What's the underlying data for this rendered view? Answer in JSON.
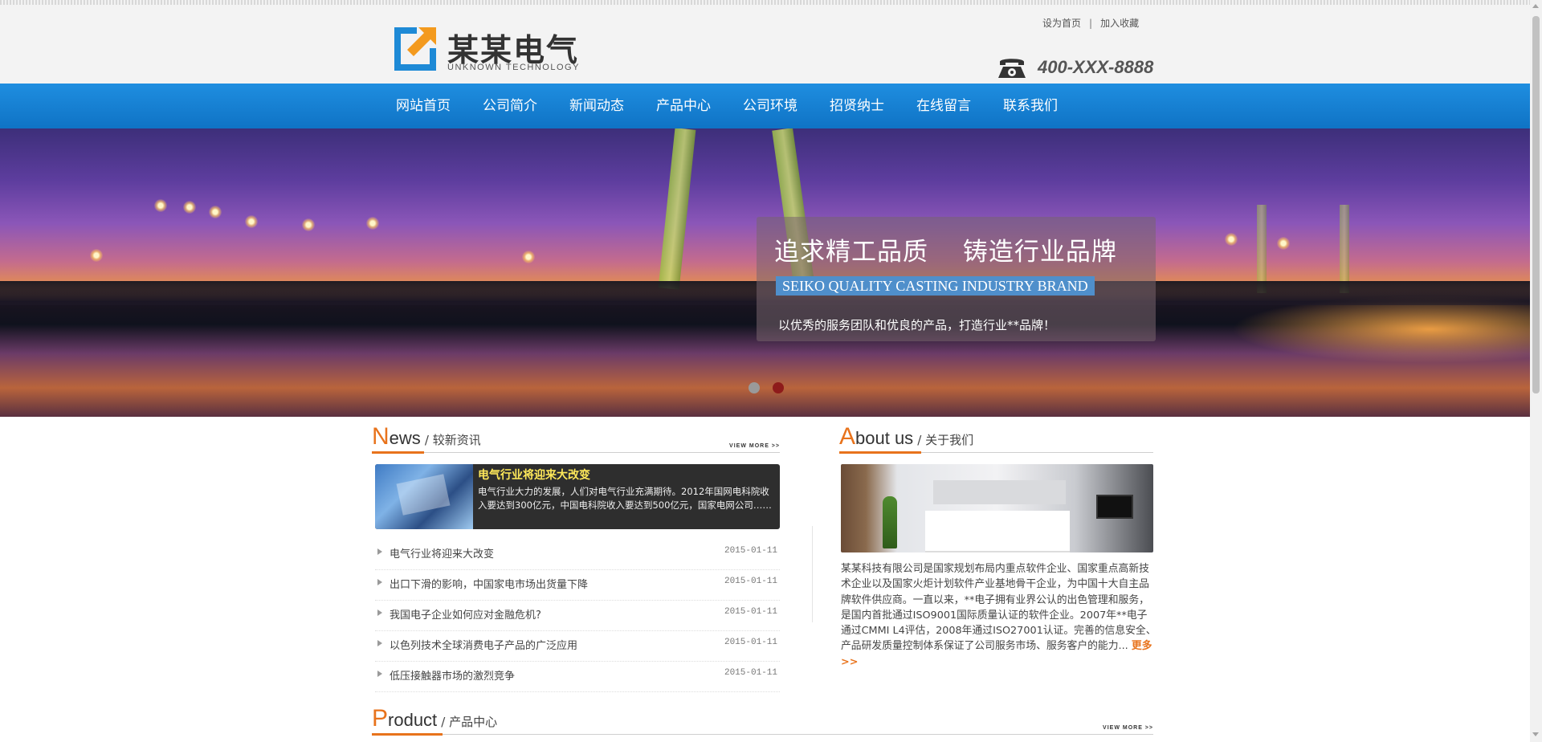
{
  "brand": {
    "name_cn": "某某电气",
    "name_en": "UNKNOWN TECHNOLOGY",
    "logo_colors": [
      "#1e8ad6",
      "#f39a1e"
    ]
  },
  "top_links": [
    "设为首页",
    "|",
    "加入收藏"
  ],
  "phone": "400-XXX-8888",
  "nav": [
    "网站首页",
    "公司简介",
    "新闻动态",
    "产品中心",
    "公司环境",
    "招贤纳士",
    "在线留言",
    "联系我们"
  ],
  "banner": {
    "title": "追求精工品质　 铸造行业品牌",
    "subtitle": "SEIKO QUALITY CASTING INDUSTRY BRAND",
    "desc": "以优秀的服务团队和优良的产品，打造行业**品牌！",
    "dots": [
      {
        "state": "inactive",
        "color": "#9a9a9a"
      },
      {
        "state": "active",
        "color": "#8e1b1b"
      }
    ]
  },
  "news": {
    "title_first": "N",
    "title_rest": "ews",
    "title_cn": "/ 较新资讯",
    "more": "VIEW MORE >>",
    "featured": {
      "title": "电气行业将迎来大改变",
      "text": "电气行业大力的发展，人们对电气行业充满期待。2012年国网电科院收入要达到300亿元，中国电科院收入要达到500亿元，国家电网公司……"
    },
    "items": [
      {
        "title": "电气行业将迎来大改变",
        "date": "2015-01-11"
      },
      {
        "title": "出口下滑的影响，中国家电市场出货量下降",
        "date": "2015-01-11"
      },
      {
        "title": "我国电子企业如何应对金融危机?",
        "date": "2015-01-11"
      },
      {
        "title": "以色列技术全球消费电子产品的广泛应用",
        "date": "2015-01-11"
      },
      {
        "title": "低压接触器市场的激烈竞争",
        "date": "2015-01-11"
      }
    ]
  },
  "about": {
    "title_first": "A",
    "title_rest": "bout us",
    "title_cn": "/ 关于我们",
    "text": "某某科技有限公司是国家规划布局内重点软件企业、国家重点高新技术企业以及国家火炬计划软件产业基地骨干企业，为中国十大自主品牌软件供应商。一直以来，**电子拥有业界公认的出色管理和服务，是国内首批通过ISO9001国际质量认证的软件企业。2007年**电子通过CMMI L4评估，2008年通过ISO27001认证。完善的信息安全、产品研发质量控制体系保证了公司服务市场、服务客户的能力...",
    "more": "更多 >>"
  },
  "product": {
    "title_first": "P",
    "title_rest": "roduct",
    "title_cn": "/ 产品中心",
    "more": "VIEW MORE >>"
  },
  "accent_color": "#e8731c",
  "nav_color": "#1680d4"
}
